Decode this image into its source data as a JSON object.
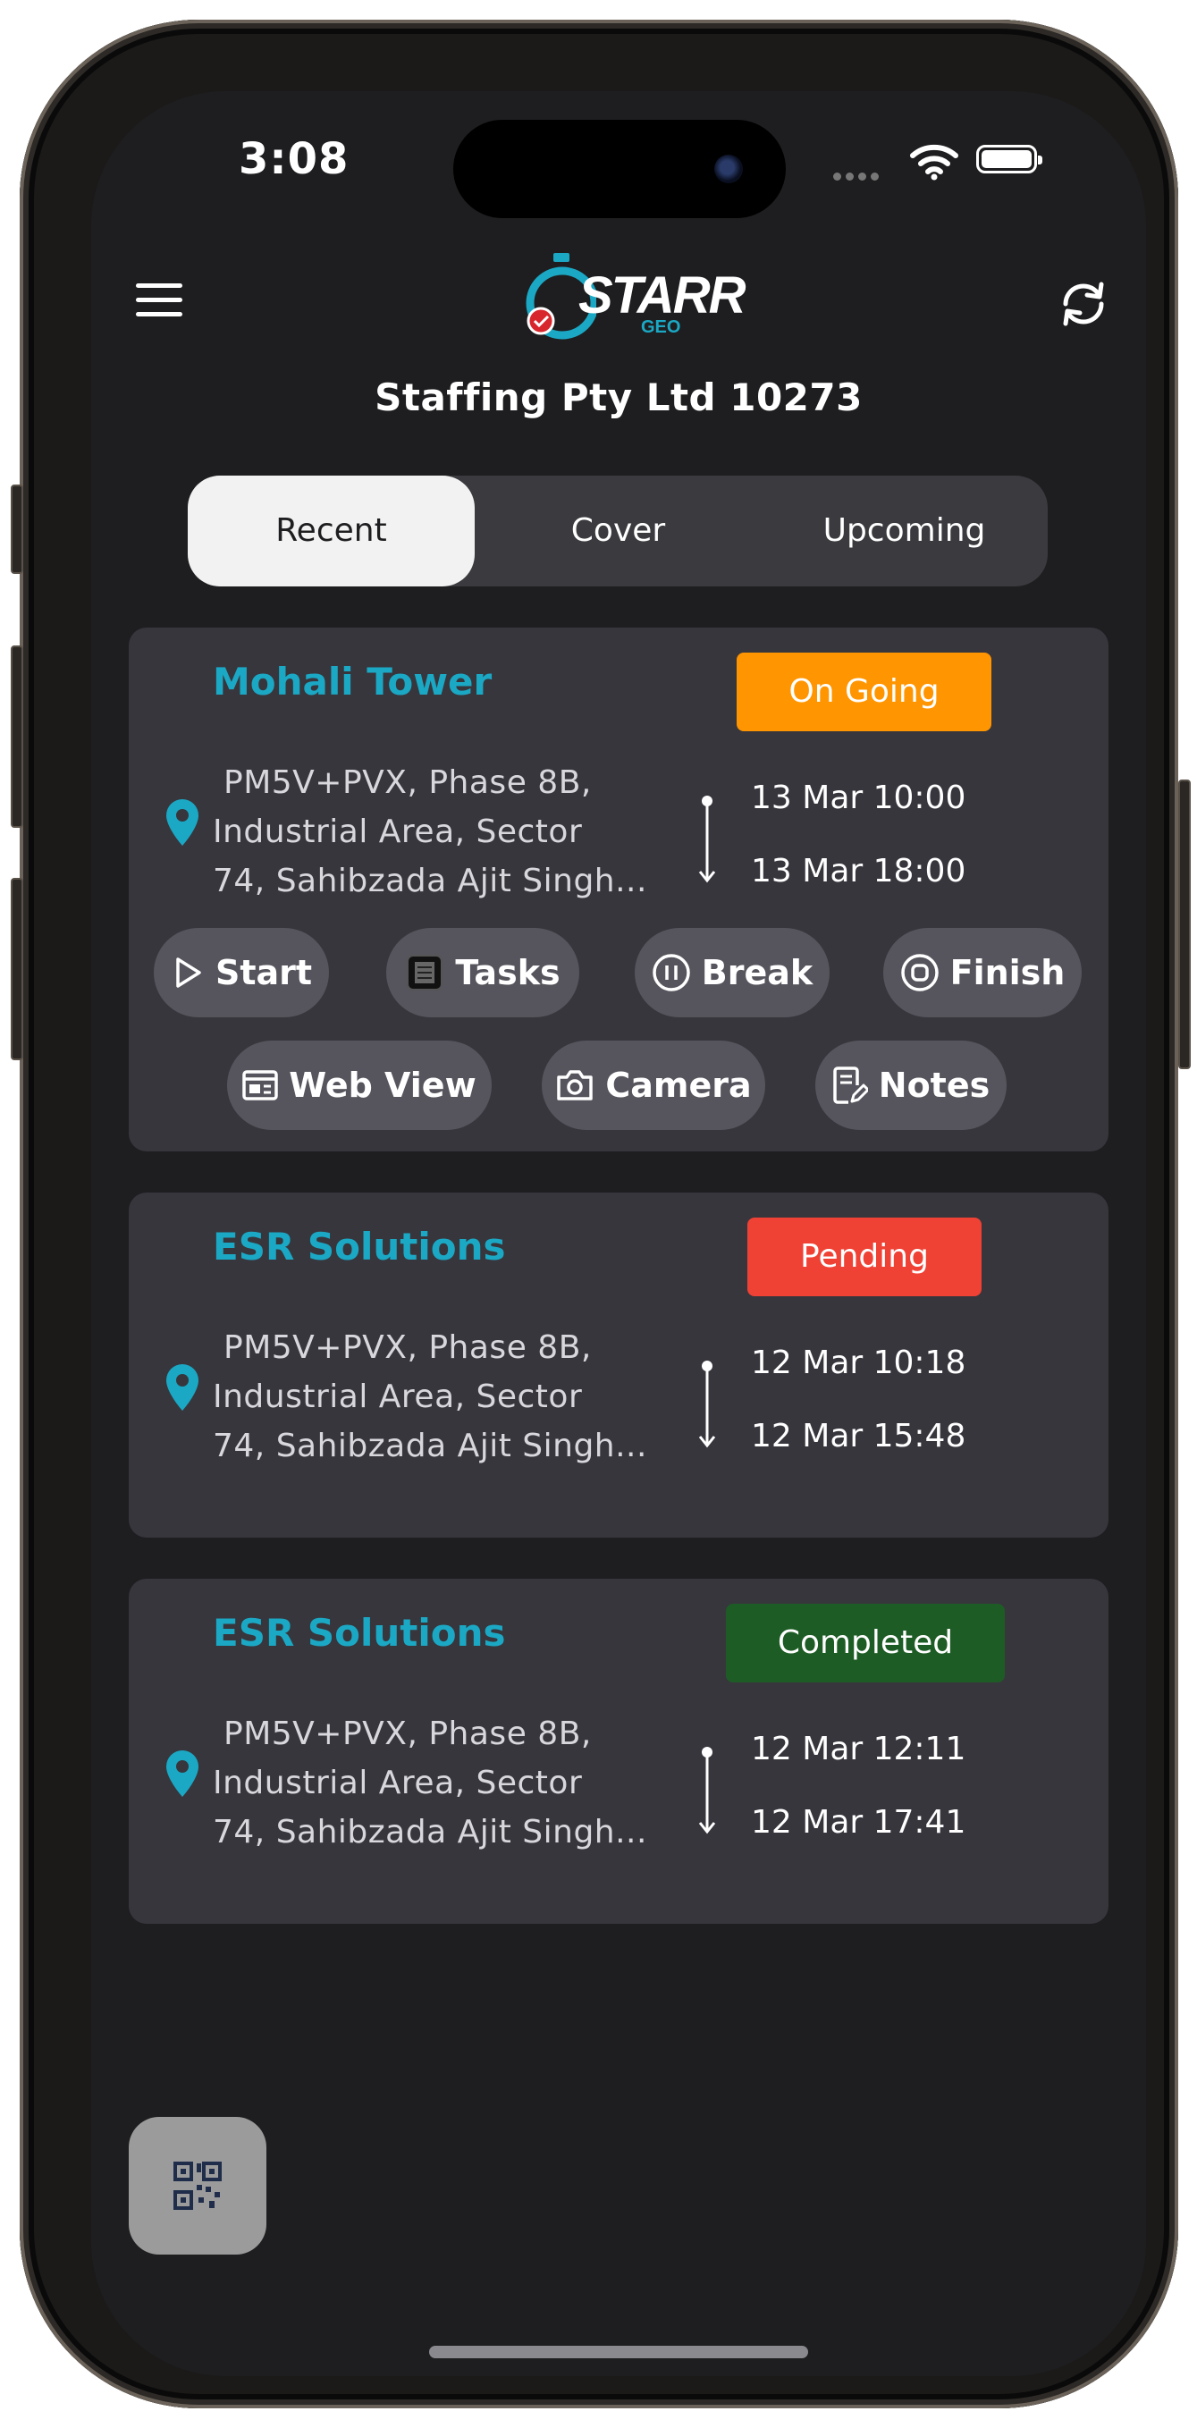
{
  "status_bar": {
    "time": "3:08"
  },
  "header": {
    "logo_text": "STARR",
    "logo_sub": "GEO",
    "title": "Staffing Pty Ltd 10273"
  },
  "tabs": [
    {
      "label": "Recent",
      "active": true
    },
    {
      "label": "Cover",
      "active": false
    },
    {
      "label": "Upcoming",
      "active": false
    }
  ],
  "shifts": [
    {
      "site": "Mohali Tower",
      "status": "On Going",
      "status_color": "#ff9500",
      "address_lines": [
        "PM5V+PVX, Phase 8B,",
        "Industrial Area, Sector",
        "74, Sahibzada Ajit Singh..."
      ],
      "start": "13 Mar 10:00",
      "end": "13 Mar 18:00",
      "actions": [
        "Start",
        "Tasks",
        "Break",
        "Finish",
        "Web View",
        "Camera",
        "Notes"
      ]
    },
    {
      "site": "ESR Solutions",
      "status": "Pending",
      "status_color": "#f04135",
      "address_lines": [
        "PM5V+PVX, Phase 8B,",
        "Industrial Area, Sector",
        "74, Sahibzada Ajit Singh..."
      ],
      "start": "12 Mar 10:18",
      "end": "12 Mar 15:48"
    },
    {
      "site": "ESR Solutions",
      "status": "Completed",
      "status_color": "#1e5c25",
      "address_lines": [
        "PM5V+PVX, Phase 8B,",
        "Industrial Area, Sector",
        "74, Sahibzada Ajit Singh..."
      ],
      "start": "12 Mar 12:11",
      "end": "12 Mar 17:41"
    }
  ],
  "icons": {
    "menu": "hamburger-icon",
    "refresh": "refresh-icon",
    "location": "location-pin-icon",
    "qr": "qr-code-icon"
  },
  "colors": {
    "accent": "#1ba8c4",
    "card_bg": "#37363d",
    "screen_bg": "#1e1e20"
  }
}
